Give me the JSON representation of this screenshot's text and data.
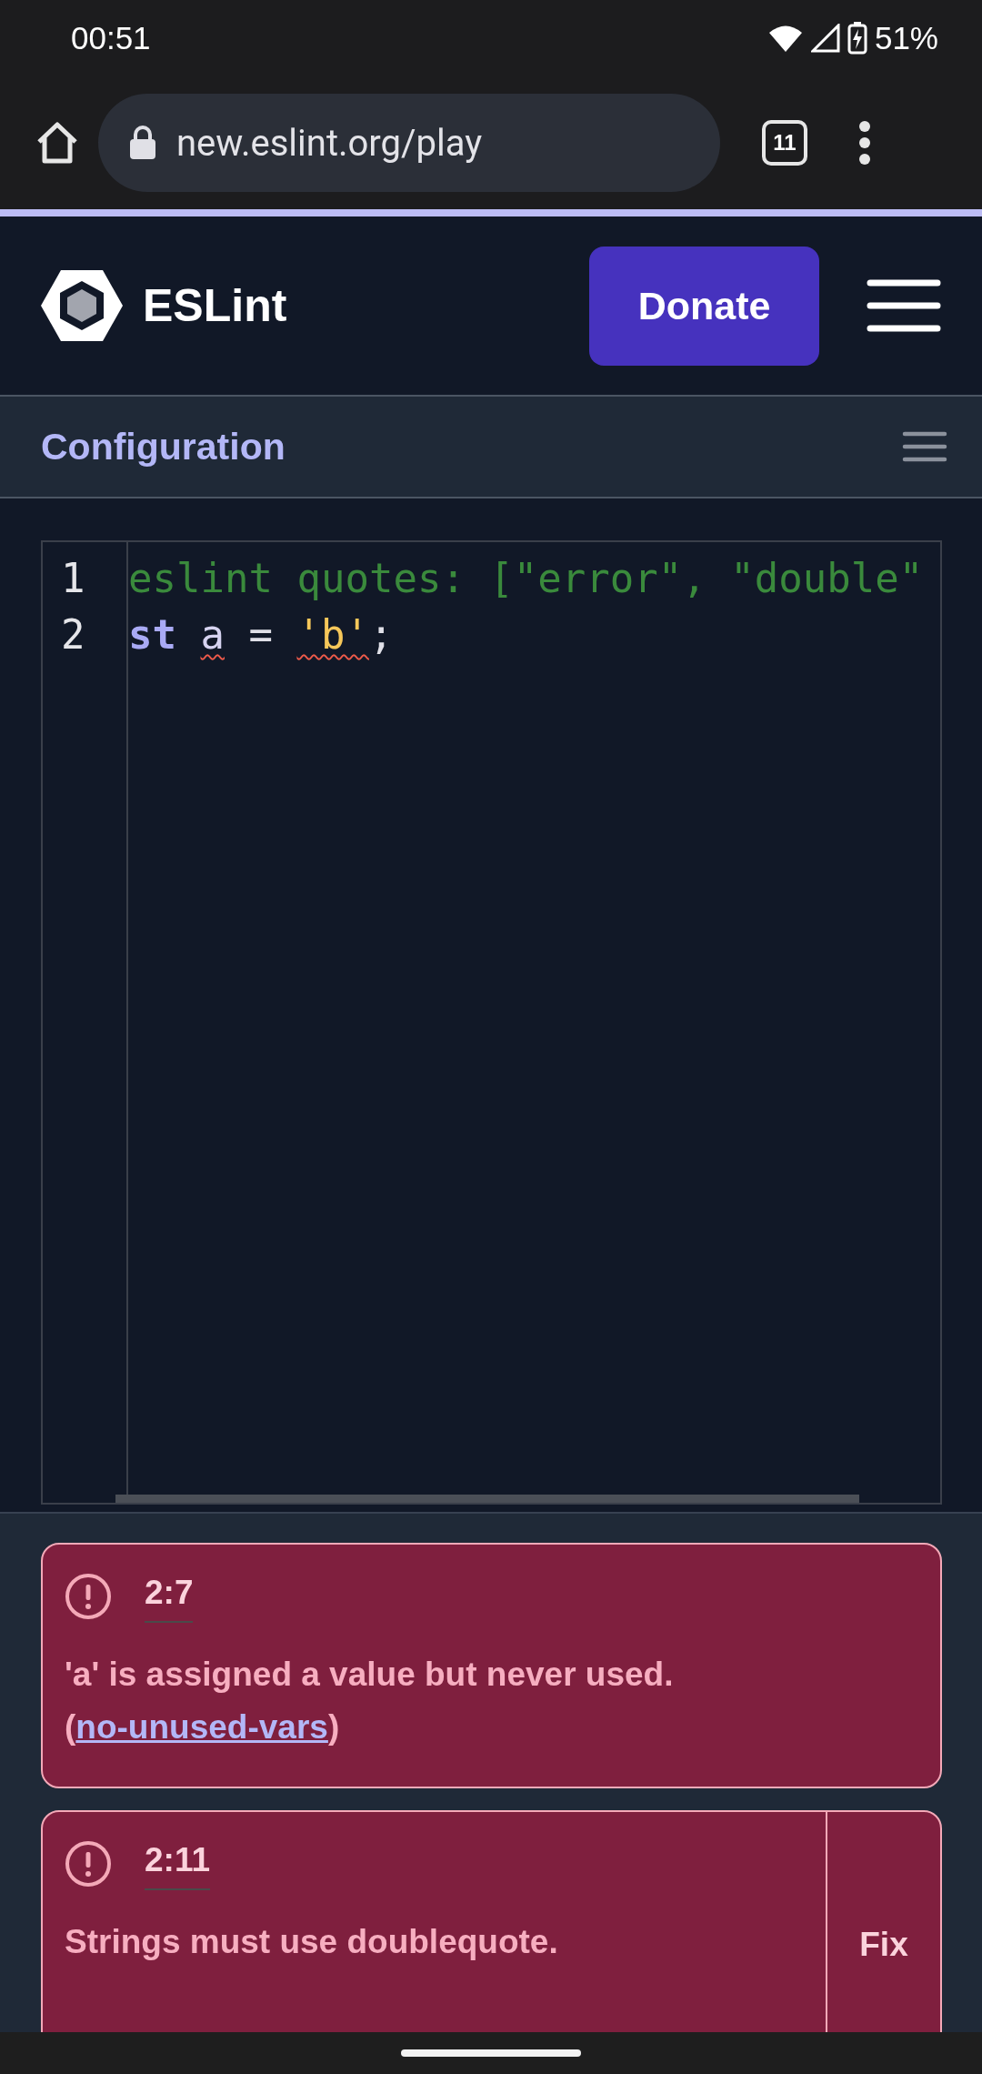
{
  "status_bar": {
    "time": "00:51",
    "battery": "51%"
  },
  "browser": {
    "url": "new.eslint.org/play",
    "tab_count": "11"
  },
  "header": {
    "logo_text": "ESLint",
    "donate_button": "Donate"
  },
  "config_bar": {
    "title": "Configuration"
  },
  "editor": {
    "lines": [
      {
        "number": "1",
        "tokens": [
          {
            "text": "eslint quotes: [\"error\", \"double\"",
            "kind": "comment",
            "error": false
          }
        ]
      },
      {
        "number": "2",
        "tokens": [
          {
            "text": "st ",
            "kind": "keyword",
            "error": false
          },
          {
            "text": "a",
            "kind": "identifier",
            "error": true
          },
          {
            "text": " = ",
            "kind": "plain",
            "error": false
          },
          {
            "text": "'b'",
            "kind": "string",
            "error": true
          },
          {
            "text": ";",
            "kind": "plain",
            "error": false
          }
        ]
      }
    ]
  },
  "problems": [
    {
      "position": "2:7",
      "parts": [
        {
          "text": "'a' is assigned a value but never used.  (",
          "kind": "text"
        },
        {
          "text": "no-unused-vars",
          "kind": "link"
        },
        {
          "text": ")",
          "kind": "text"
        }
      ]
    },
    {
      "position": "2:11",
      "parts": [
        {
          "text": "Strings must use doublequote.",
          "kind": "text"
        }
      ],
      "fix_button": "Fix"
    }
  ]
}
